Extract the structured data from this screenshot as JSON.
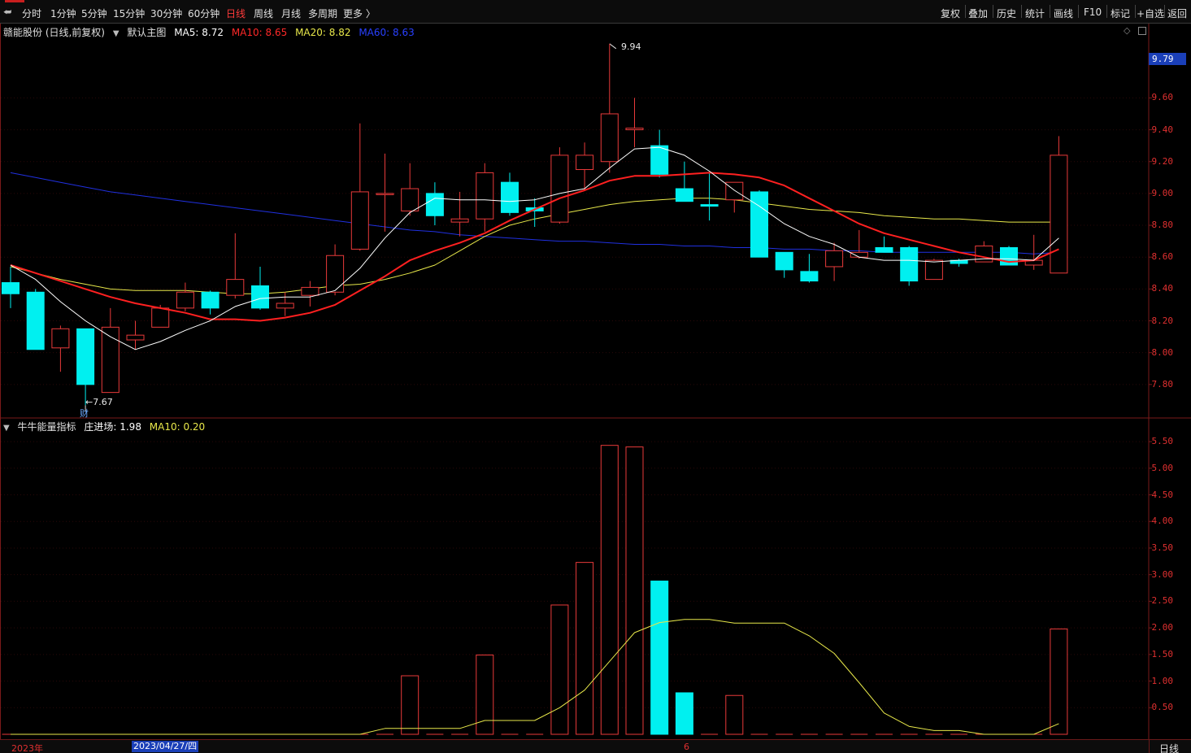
{
  "toolbar": {
    "period_tabs": [
      "分时",
      "1分钟",
      "5分钟",
      "15分钟",
      "30分钟",
      "60分钟",
      "日线",
      "周线",
      "月线",
      "多周期",
      "更多 〉"
    ],
    "active_tab": "日线",
    "right_tools": [
      "复权",
      "叠加",
      "历史",
      "统计",
      "画线",
      "F10",
      "标记",
      "+自选",
      "返回"
    ]
  },
  "main_panel": {
    "stock_title": "赣能股份 (日线,前复权)",
    "template": "默认主图",
    "ma5": "MA5: 8.72",
    "ma10": "MA10: 8.65",
    "ma20": "MA20: 8.82",
    "ma60": "MA60: 8.63",
    "high_annotation": "9.94",
    "low_annotation": "←7.67",
    "event_tag": "财",
    "current_price": "9.79",
    "price_ticks": [
      "9.60",
      "9.40",
      "9.20",
      "9.00",
      "8.80",
      "8.60",
      "8.40",
      "8.20",
      "8.00",
      "7.80"
    ]
  },
  "sub_panel": {
    "indicator": "牛牛能量指标",
    "value": "庄进场: 1.98",
    "ma10": "MA10: 0.20",
    "ticks": [
      "5.50",
      "5.00",
      "4.50",
      "4.00",
      "3.50",
      "3.00",
      "2.50",
      "2.00",
      "1.50",
      "1.00",
      "0.50"
    ]
  },
  "bottom_bar": {
    "year": "2023年",
    "cursor_date": "2023/04/27/四",
    "month_mark": "6",
    "period": "日线"
  },
  "colors": {
    "up": "#e83a3a",
    "down": "#00f0f0",
    "ma5": "#ffffff",
    "ma10": "#ff2020",
    "ma20": "#e8e84a",
    "ma60": "#2030e0",
    "axis": "#7a1a1a"
  },
  "chart_data": {
    "type": "candlestick",
    "price_ylim": [
      7.6,
      9.98
    ],
    "candles": [
      {
        "o": 8.44,
        "h": 8.54,
        "l": 8.28,
        "c": 8.37
      },
      {
        "o": 8.38,
        "h": 8.4,
        "l": 8.02,
        "c": 8.02
      },
      {
        "o": 8.03,
        "h": 8.17,
        "l": 7.88,
        "c": 8.15
      },
      {
        "o": 8.15,
        "h": 8.15,
        "l": 7.67,
        "c": 7.8
      },
      {
        "o": 7.75,
        "h": 8.28,
        "l": 7.75,
        "c": 8.16
      },
      {
        "o": 8.08,
        "h": 8.2,
        "l": 8.02,
        "c": 8.11
      },
      {
        "o": 8.16,
        "h": 8.3,
        "l": 8.16,
        "c": 8.28
      },
      {
        "o": 8.28,
        "h": 8.44,
        "l": 8.26,
        "c": 8.38
      },
      {
        "o": 8.38,
        "h": 8.39,
        "l": 8.24,
        "c": 8.28
      },
      {
        "o": 8.36,
        "h": 8.75,
        "l": 8.34,
        "c": 8.46
      },
      {
        "o": 8.42,
        "h": 8.54,
        "l": 8.27,
        "c": 8.28
      },
      {
        "o": 8.28,
        "h": 8.38,
        "l": 8.23,
        "c": 8.31
      },
      {
        "o": 8.36,
        "h": 8.45,
        "l": 8.29,
        "c": 8.41
      },
      {
        "o": 8.38,
        "h": 8.68,
        "l": 8.36,
        "c": 8.61
      },
      {
        "o": 8.65,
        "h": 9.44,
        "l": 8.64,
        "c": 9.01
      },
      {
        "o": 9.0,
        "h": 9.25,
        "l": 8.76,
        "c": 9.0
      },
      {
        "o": 8.89,
        "h": 9.19,
        "l": 8.86,
        "c": 9.03
      },
      {
        "o": 9.0,
        "h": 9.07,
        "l": 8.8,
        "c": 8.86
      },
      {
        "o": 8.82,
        "h": 9.01,
        "l": 8.73,
        "c": 8.84
      },
      {
        "o": 8.84,
        "h": 9.19,
        "l": 8.76,
        "c": 9.13
      },
      {
        "o": 9.07,
        "h": 9.13,
        "l": 8.86,
        "c": 8.88
      },
      {
        "o": 8.91,
        "h": 8.97,
        "l": 8.79,
        "c": 8.89
      },
      {
        "o": 8.82,
        "h": 9.29,
        "l": 8.81,
        "c": 9.24
      },
      {
        "o": 9.15,
        "h": 9.32,
        "l": 9.02,
        "c": 9.24
      },
      {
        "o": 9.2,
        "h": 9.94,
        "l": 9.13,
        "c": 9.5
      },
      {
        "o": 9.4,
        "h": 9.6,
        "l": 9.29,
        "c": 9.41
      },
      {
        "o": 9.3,
        "h": 9.4,
        "l": 9.1,
        "c": 9.12
      },
      {
        "o": 9.03,
        "h": 9.2,
        "l": 8.95,
        "c": 8.95
      },
      {
        "o": 8.93,
        "h": 9.13,
        "l": 8.83,
        "c": 8.92
      },
      {
        "o": 8.96,
        "h": 9.07,
        "l": 8.88,
        "c": 9.07
      },
      {
        "o": 9.01,
        "h": 9.02,
        "l": 8.6,
        "c": 8.6
      },
      {
        "o": 8.63,
        "h": 8.63,
        "l": 8.47,
        "c": 8.52
      },
      {
        "o": 8.51,
        "h": 8.62,
        "l": 8.44,
        "c": 8.45
      },
      {
        "o": 8.54,
        "h": 8.69,
        "l": 8.45,
        "c": 8.64
      },
      {
        "o": 8.6,
        "h": 8.77,
        "l": 8.59,
        "c": 8.63
      },
      {
        "o": 8.66,
        "h": 8.73,
        "l": 8.63,
        "c": 8.63
      },
      {
        "o": 8.66,
        "h": 8.67,
        "l": 8.42,
        "c": 8.45
      },
      {
        "o": 8.46,
        "h": 8.59,
        "l": 8.46,
        "c": 8.58
      },
      {
        "o": 8.58,
        "h": 8.59,
        "l": 8.54,
        "c": 8.56
      },
      {
        "o": 8.57,
        "h": 8.7,
        "l": 8.57,
        "c": 8.67
      },
      {
        "o": 8.66,
        "h": 8.67,
        "l": 8.55,
        "c": 8.55
      },
      {
        "o": 8.55,
        "h": 8.74,
        "l": 8.52,
        "c": 8.58
      },
      {
        "o": 8.5,
        "h": 9.36,
        "l": 8.5,
        "c": 9.24
      }
    ],
    "ma5": [
      8.55,
      8.46,
      8.32,
      8.2,
      8.1,
      8.02,
      8.07,
      8.14,
      8.2,
      8.29,
      8.34,
      8.35,
      8.35,
      8.39,
      8.53,
      8.72,
      8.88,
      8.97,
      8.96,
      8.96,
      8.95,
      8.96,
      9.0,
      9.03,
      9.16,
      9.28,
      9.29,
      9.24,
      9.14,
      9.02,
      8.92,
      8.81,
      8.73,
      8.68,
      8.6,
      8.58,
      8.58,
      8.57,
      8.58,
      8.59,
      8.59,
      8.58,
      8.72
    ],
    "ma10": [
      8.55,
      8.5,
      8.45,
      8.4,
      8.35,
      8.31,
      8.28,
      8.25,
      8.21,
      8.21,
      8.2,
      8.22,
      8.25,
      8.3,
      8.39,
      8.48,
      8.58,
      8.64,
      8.69,
      8.75,
      8.83,
      8.9,
      8.97,
      9.02,
      9.08,
      9.11,
      9.11,
      9.12,
      9.13,
      9.12,
      9.1,
      9.05,
      8.97,
      8.89,
      8.81,
      8.75,
      8.71,
      8.67,
      8.63,
      8.6,
      8.57,
      8.58,
      8.65
    ],
    "ma20": [
      8.54,
      8.5,
      8.46,
      8.43,
      8.4,
      8.39,
      8.39,
      8.39,
      8.38,
      8.37,
      8.37,
      8.38,
      8.4,
      8.42,
      8.43,
      8.46,
      8.5,
      8.55,
      8.64,
      8.73,
      8.8,
      8.84,
      8.87,
      8.9,
      8.93,
      8.95,
      8.96,
      8.97,
      8.97,
      8.96,
      8.94,
      8.92,
      8.9,
      8.89,
      8.88,
      8.86,
      8.85,
      8.84,
      8.84,
      8.83,
      8.82,
      8.82,
      8.82
    ],
    "ma60": [
      9.13,
      9.1,
      9.07,
      9.04,
      9.01,
      8.99,
      8.97,
      8.95,
      8.93,
      8.91,
      8.89,
      8.87,
      8.85,
      8.83,
      8.81,
      8.79,
      8.77,
      8.76,
      8.74,
      8.73,
      8.72,
      8.71,
      8.7,
      8.7,
      8.69,
      8.68,
      8.68,
      8.67,
      8.67,
      8.66,
      8.66,
      8.65,
      8.65,
      8.64,
      8.64,
      8.63,
      8.63,
      8.63,
      8.63,
      8.63,
      8.63,
      8.62,
      8.63
    ],
    "energy_ylim": [
      0,
      5.7
    ],
    "energy": [
      0,
      0,
      0,
      0,
      0,
      0,
      0,
      0,
      0,
      0,
      0,
      0,
      0,
      0,
      0,
      0,
      1.1,
      0,
      0,
      1.49,
      0,
      0,
      2.43,
      3.23,
      5.43,
      5.4,
      2.88,
      0.78,
      0,
      0.73,
      0,
      0,
      0,
      0,
      0,
      0,
      0,
      0,
      0,
      0,
      0,
      0,
      1.98
    ],
    "energy_up": [
      true,
      true,
      true,
      true,
      true,
      true,
      true,
      true,
      true,
      true,
      true,
      true,
      true,
      true,
      true,
      true,
      true,
      true,
      true,
      true,
      true,
      true,
      true,
      true,
      true,
      true,
      false,
      false,
      true,
      true,
      true,
      true,
      true,
      true,
      true,
      true,
      true,
      true,
      true,
      true,
      true,
      true,
      true
    ],
    "energy_ma10": [
      0,
      0,
      0,
      0,
      0,
      0,
      0,
      0,
      0,
      0,
      0,
      0,
      0,
      0,
      0,
      0.11,
      0.11,
      0.11,
      0.11,
      0.26,
      0.26,
      0.26,
      0.5,
      0.83,
      1.37,
      1.91,
      2.1,
      2.16,
      2.16,
      2.09,
      2.09,
      2.09,
      1.85,
      1.52,
      0.97,
      0.4,
      0.15,
      0.07,
      0.07,
      0,
      0,
      0,
      0.2
    ]
  }
}
